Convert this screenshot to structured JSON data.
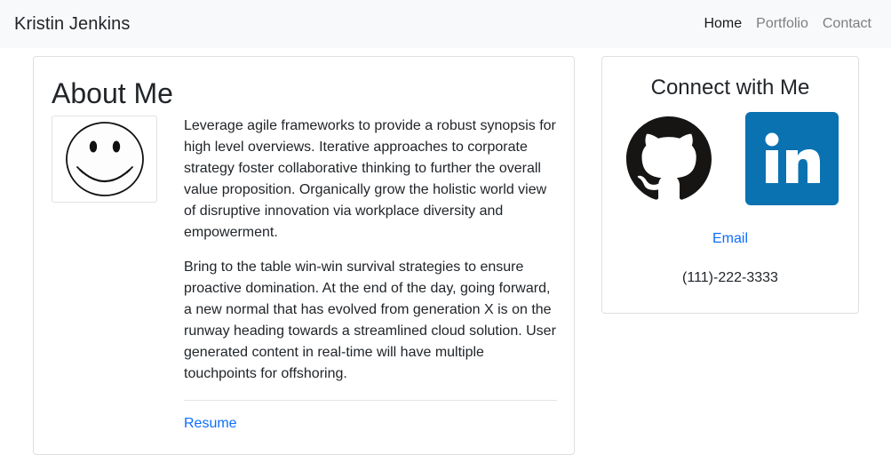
{
  "navbar": {
    "brand": "Kristin Jenkins",
    "links": [
      {
        "label": "Home",
        "active": true
      },
      {
        "label": "Portfolio",
        "active": false
      },
      {
        "label": "Contact",
        "active": false
      }
    ]
  },
  "about": {
    "title": "About Me",
    "avatar_icon": "smiley-face-icon",
    "paragraphs": [
      "Leverage agile frameworks to provide a robust synopsis for high level overviews. Iterative approaches to corporate strategy foster collaborative thinking to further the overall value proposition. Organically grow the holistic world view of disruptive innovation via workplace diversity and empowerment.",
      "Bring to the table win-win survival strategies to ensure proactive domination. At the end of the day, going forward, a new normal that has evolved from generation X is on the runway heading towards a streamlined cloud solution. User generated content in real-time will have multiple touchpoints for offshoring."
    ],
    "resume_label": "Resume"
  },
  "connect": {
    "title": "Connect with Me",
    "github_icon": "github-icon",
    "linkedin_icon": "linkedin-icon",
    "email_label": "Email",
    "phone": "(111)-222-3333"
  },
  "colors": {
    "link": "#0d6efd",
    "navbar_bg": "#f8f9fa",
    "linkedin": "#0a72b1",
    "text": "#212529"
  }
}
